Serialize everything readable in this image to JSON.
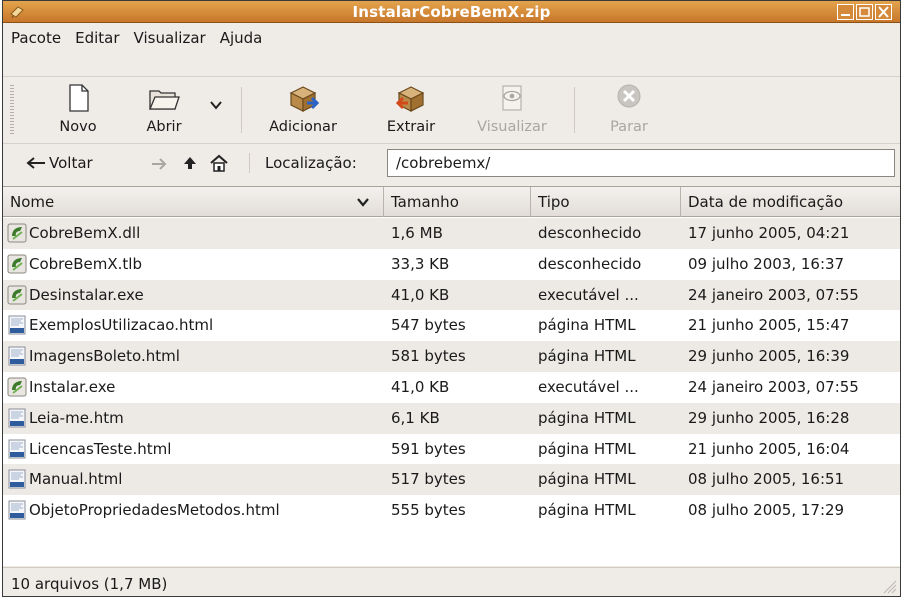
{
  "window": {
    "title": "InstalarCobreBemX.zip"
  },
  "menubar": {
    "items": [
      "Pacote",
      "Editar",
      "Visualizar",
      "Ajuda"
    ]
  },
  "toolbar": {
    "novo": "Novo",
    "abrir": "Abrir",
    "adicionar": "Adicionar",
    "extrair": "Extrair",
    "visualizar": "Visualizar",
    "parar": "Parar"
  },
  "location": {
    "back": "Voltar",
    "label": "Localização:",
    "path": "/cobrebemx/"
  },
  "table": {
    "headers": [
      "Nome",
      "Tamanho",
      "Tipo",
      "Data de modificação"
    ],
    "rows": [
      {
        "name": "CobreBemX.dll",
        "size": "1,6 MB",
        "type": "desconhecido",
        "date": "17 junho 2005, 04:21",
        "icon": "binary-file-icon"
      },
      {
        "name": "CobreBemX.tlb",
        "size": "33,3 KB",
        "type": "desconhecido",
        "date": "09 julho 2003, 16:37",
        "icon": "binary-file-icon"
      },
      {
        "name": "Desinstalar.exe",
        "size": "41,0 KB",
        "type": "executável ...",
        "date": "24 janeiro 2003, 07:55",
        "icon": "binary-file-icon"
      },
      {
        "name": "ExemplosUtilizacao.html",
        "size": "547 bytes",
        "type": "página HTML",
        "date": "21 junho 2005, 15:47",
        "icon": "html-file-icon"
      },
      {
        "name": "ImagensBoleto.html",
        "size": "581 bytes",
        "type": "página HTML",
        "date": "29 junho 2005, 16:39",
        "icon": "html-file-icon"
      },
      {
        "name": "Instalar.exe",
        "size": "41,0 KB",
        "type": "executável ...",
        "date": "24 janeiro 2003, 07:55",
        "icon": "binary-file-icon"
      },
      {
        "name": "Leia-me.htm",
        "size": "6,1 KB",
        "type": "página HTML",
        "date": "29 junho 2005, 16:28",
        "icon": "html-file-icon"
      },
      {
        "name": "LicencasTeste.html",
        "size": "591 bytes",
        "type": "página HTML",
        "date": "21 junho 2005, 16:04",
        "icon": "html-file-icon"
      },
      {
        "name": "Manual.html",
        "size": "517 bytes",
        "type": "página HTML",
        "date": "08 julho 2005, 16:51",
        "icon": "html-file-icon"
      },
      {
        "name": "ObjetoPropriedadesMetodos.html",
        "size": "555 bytes",
        "type": "página HTML",
        "date": "08 julho 2005, 17:29",
        "icon": "html-file-icon"
      }
    ]
  },
  "status": {
    "text": "10 arquivos (1,7 MB)"
  },
  "colors": {
    "titlebar": "#d48a3a",
    "row_alt": "#edeae6",
    "window_bg": "#efebe7"
  }
}
